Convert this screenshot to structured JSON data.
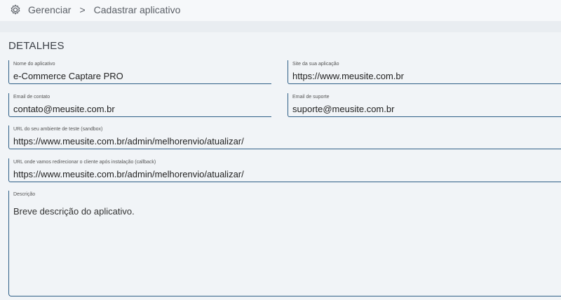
{
  "breadcrumb": {
    "items": [
      "Gerenciar",
      "Cadastrar aplicativo"
    ],
    "separator": ">"
  },
  "section": {
    "title": "DETALHES"
  },
  "fields": {
    "nome": {
      "label": "Nome do aplicativo",
      "value": "e-Commerce Captare PRO"
    },
    "site": {
      "label": "Site da sua aplicação",
      "value": "https://www.meusite.com.br"
    },
    "email": {
      "label": "Email de contato",
      "value": "contato@meusite.com.br"
    },
    "suporte": {
      "label": "Email de suporte",
      "value": "suporte@meusite.com.br"
    },
    "sandbox": {
      "label": "URL do seu ambiente de teste (sandbox)",
      "value": "https://www.meusite.com.br/admin/melhorenvio/atualizar/"
    },
    "callback": {
      "label": "URL onde vamos redirecionar o cliente após instalação (callback)",
      "value": "https://www.meusite.com.br/admin/melhorenvio/atualizar/"
    },
    "descricao": {
      "label": "Descrição",
      "value": "Breve descrição do aplicativo."
    }
  },
  "colors": {
    "field_border": "#2f5f86",
    "background": "#f1f4f7"
  },
  "icons": {
    "breadcrumb_icon": "gear-icon"
  }
}
